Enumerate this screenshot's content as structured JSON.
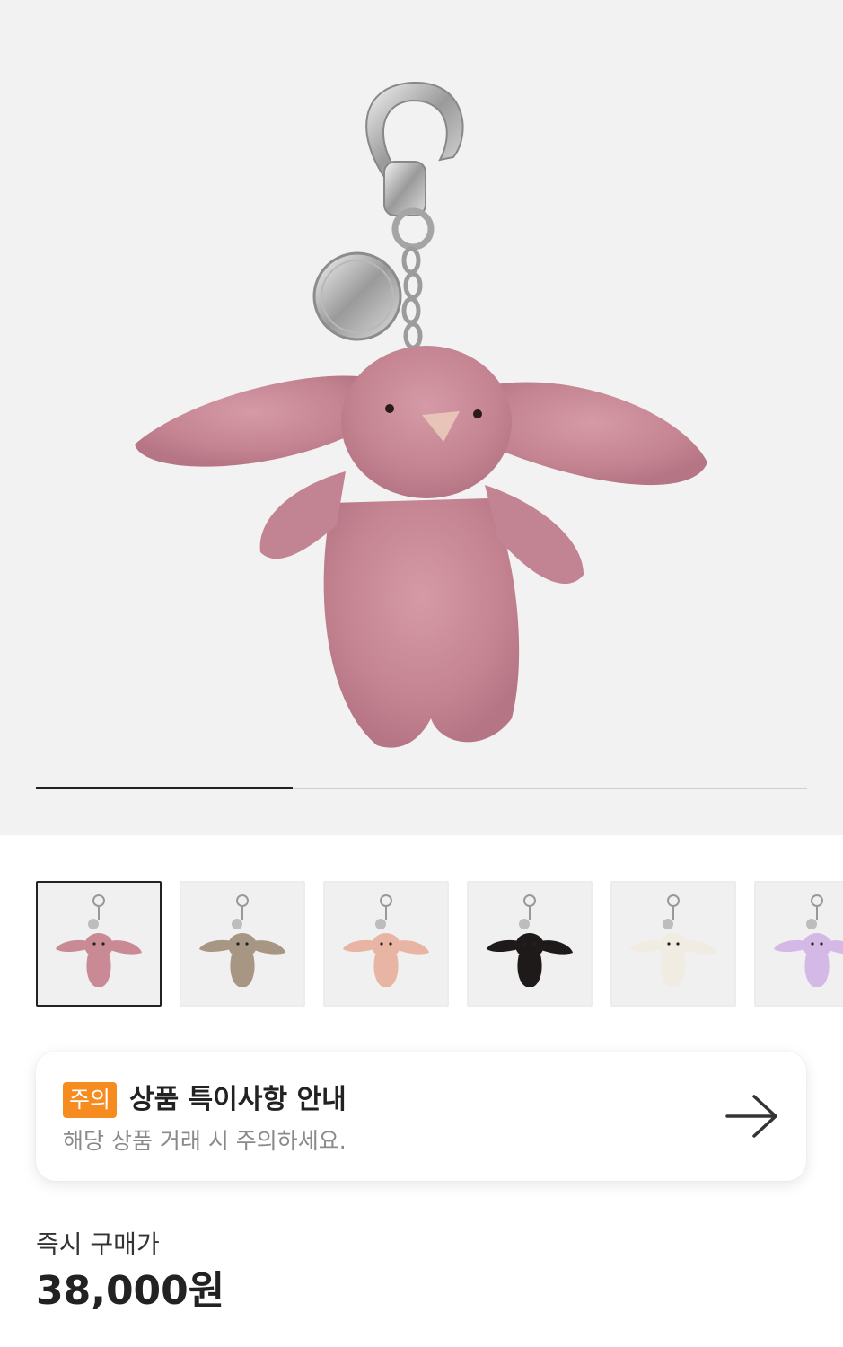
{
  "carousel": {
    "progress_fraction": 0.333
  },
  "thumbnails": [
    {
      "color": "#c98a96",
      "selected": true
    },
    {
      "color": "#a79684",
      "selected": false
    },
    {
      "color": "#e8b5a4",
      "selected": false
    },
    {
      "color": "#1e1a1a",
      "selected": false
    },
    {
      "color": "#f1ece2",
      "selected": false
    },
    {
      "color": "#d4b9e6",
      "selected": false
    }
  ],
  "notice": {
    "badge": "주의",
    "title": "상품 특이사항 안내",
    "subtitle": "해당 상품 거래 시 주의하세요."
  },
  "price": {
    "label": "즉시 구매가",
    "value": "38,000원"
  },
  "colors": {
    "accent": "#f68b1f",
    "product_pink": "#c98a96"
  }
}
